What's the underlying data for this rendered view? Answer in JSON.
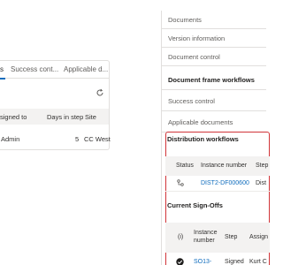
{
  "left_panel": {
    "tabs": [
      "s",
      "Success cont...",
      "Applicable d..."
    ],
    "columns": [
      "signed to",
      "Days in step",
      "Site"
    ],
    "row": {
      "assigned_to": "Admin",
      "days": "5",
      "site": "CC West"
    }
  },
  "nav": {
    "items": [
      "Documents",
      "Version information",
      "Document control",
      "Document frame workflows",
      "Success control",
      "Applicable documents"
    ]
  },
  "distribution": {
    "title": "Distribution workflows",
    "columns": [
      "Status",
      "Instance number",
      "Step"
    ],
    "row": {
      "instance": "DIST2-DF000600",
      "step": "Dist"
    }
  },
  "signoffs": {
    "title": "Current Sign-Offs",
    "columns": [
      "(i)",
      "Instance number",
      "Step",
      "Assign"
    ],
    "row": {
      "instance": "SO13-DF000600",
      "step": "Signed Off",
      "assignee": "Kurt C Quality"
    }
  },
  "colors": {
    "accent": "#0f6cbd",
    "highlight": "#d13438"
  }
}
